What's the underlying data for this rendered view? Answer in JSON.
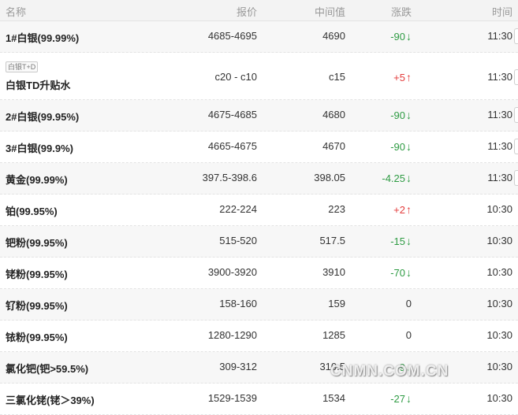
{
  "header": {
    "name": "名称",
    "price": "报价",
    "mid": "中间值",
    "change": "涨跌",
    "time": "时间"
  },
  "rows": [
    {
      "name": "1#白银(99.99%)",
      "price": "4685-4695",
      "mid": "4690",
      "change": "-90",
      "trend": "down",
      "time": "11:30"
    },
    {
      "tag": "白银T+D",
      "name": "白银TD升贴水",
      "price": "c20 - c10",
      "mid": "c15",
      "change": "+5",
      "trend": "up",
      "time": "11:30"
    },
    {
      "name": "2#白银(99.95%)",
      "price": "4675-4685",
      "mid": "4680",
      "change": "-90",
      "trend": "down",
      "time": "11:30"
    },
    {
      "name": "3#白银(99.9%)",
      "price": "4665-4675",
      "mid": "4670",
      "change": "-90",
      "trend": "down",
      "time": "11:30"
    },
    {
      "name": "黄金(99.99%)",
      "price": "397.5-398.6",
      "mid": "398.05",
      "change": "-4.25",
      "trend": "down",
      "time": "11:30"
    },
    {
      "name": "铂(99.95%)",
      "price": "222-224",
      "mid": "223",
      "change": "+2",
      "trend": "up",
      "time": "10:30"
    },
    {
      "name": "钯粉(99.95%)",
      "price": "515-520",
      "mid": "517.5",
      "change": "-15",
      "trend": "down",
      "time": "10:30"
    },
    {
      "name": "铑粉(99.95%)",
      "price": "3900-3920",
      "mid": "3910",
      "change": "-70",
      "trend": "down",
      "time": "10:30"
    },
    {
      "name": "钌粉(99.95%)",
      "price": "158-160",
      "mid": "159",
      "change": "0",
      "trend": "flat",
      "time": "10:30"
    },
    {
      "name": "铱粉(99.95%)",
      "price": "1280-1290",
      "mid": "1285",
      "change": "0",
      "trend": "flat",
      "time": "10:30"
    },
    {
      "name": "氯化钯(钯>59.5%)",
      "price": "309-312",
      "mid": "310.5",
      "change": "-9",
      "trend": "down",
      "time": "10:30"
    },
    {
      "name": "三氯化铑(铑＞39%)",
      "price": "1529-1539",
      "mid": "1534",
      "change": "-27",
      "trend": "down",
      "time": "10:30"
    }
  ],
  "arrows": {
    "up": "↑",
    "down": "↓",
    "flat": ""
  },
  "watermark": "CNMN.COM.CN"
}
